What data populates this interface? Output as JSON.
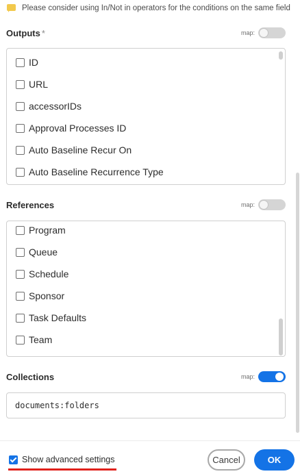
{
  "notice": {
    "icon": "comment-icon",
    "text": "Please consider using In/Not in operators for the conditions on the same field"
  },
  "outputs": {
    "title": "Outputs",
    "required_mark": "*",
    "map_label": "map:",
    "map_enabled": false,
    "items": [
      "ID",
      "URL",
      "accessorIDs",
      "Approval Processes ID",
      "Auto Baseline Recur On",
      "Auto Baseline Recurrence Type"
    ]
  },
  "references": {
    "title": "References",
    "map_label": "map:",
    "map_enabled": false,
    "items": [
      "Program",
      "Queue",
      "Schedule",
      "Sponsor",
      "Task Defaults",
      "Team"
    ]
  },
  "collections": {
    "title": "Collections",
    "map_label": "map:",
    "map_enabled": true,
    "value": "documents:folders"
  },
  "footer": {
    "advanced_label": "Show advanced settings",
    "advanced_checked": true,
    "cancel_label": "Cancel",
    "ok_label": "OK"
  },
  "colors": {
    "accent": "#1473e6",
    "highlight": "#e0201b",
    "notice": "#f2c94c"
  }
}
